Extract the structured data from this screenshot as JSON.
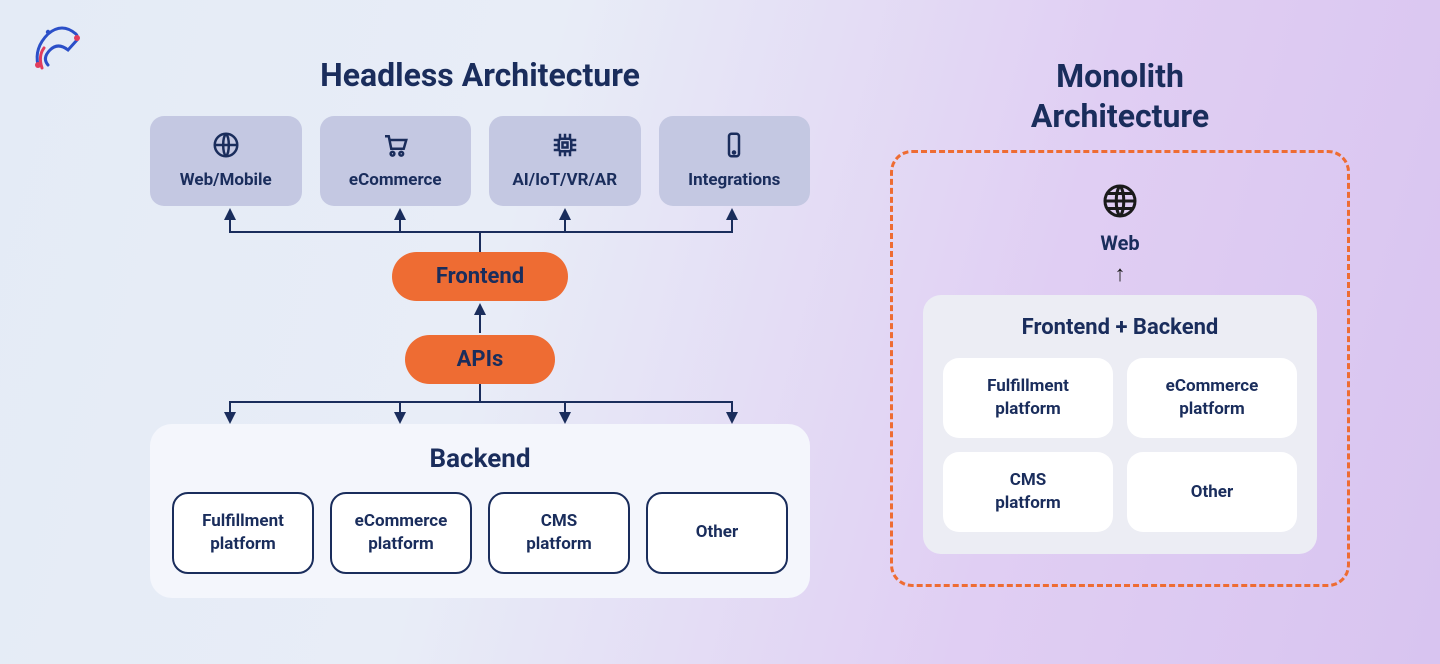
{
  "colors": {
    "text": "#1a2d5c",
    "accent": "#ee6c33",
    "channelCard": "#c4c8e2",
    "panel": "#f4f6fc",
    "monoPanel": "#ecedf4"
  },
  "headless": {
    "title": "Headless Architecture",
    "channels": [
      {
        "icon": "globe-icon",
        "label": "Web/Mobile"
      },
      {
        "icon": "cart-icon",
        "label": "eCommerce"
      },
      {
        "icon": "chip-icon",
        "label": "AI/IoT/VR/AR"
      },
      {
        "icon": "phone-icon",
        "label": "Integrations"
      }
    ],
    "frontend_label": "Frontend",
    "apis_label": "APIs",
    "backend_title": "Backend",
    "backend_items": [
      "Fulfillment\nplatform",
      "eCommerce\nplatform",
      "CMS\nplatform",
      "Other"
    ]
  },
  "monolith": {
    "title": "Monolith\nArchitecture",
    "web_label": "Web",
    "panel_title": "Frontend + Backend",
    "items": [
      "Fulfillment\nplatform",
      "eCommerce\nplatform",
      "CMS\nplatform",
      "Other"
    ]
  }
}
